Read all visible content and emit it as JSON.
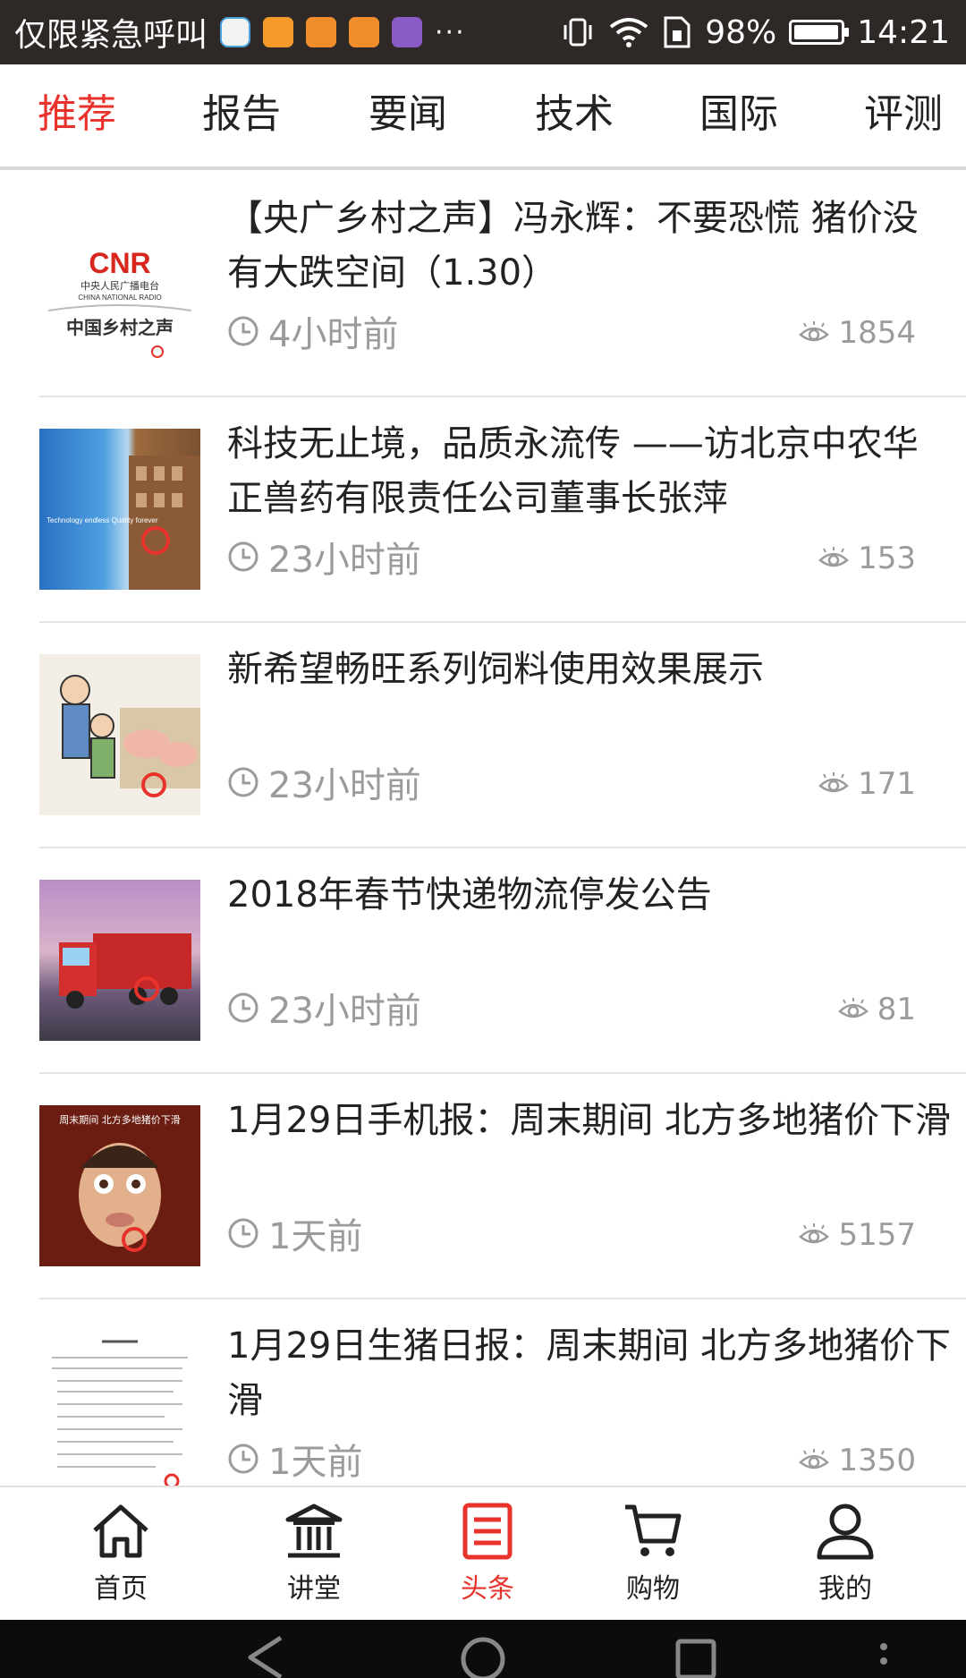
{
  "status_bar": {
    "carrier": "仅限紧急呼叫",
    "battery": "98%",
    "battery_level": 0.98,
    "time": "14:21",
    "notification_icons": [
      "browser-icon",
      "app-icon",
      "uc-icon",
      "uc-icon",
      "gallery-icon"
    ]
  },
  "tabs": [
    {
      "label": "推荐",
      "active": true
    },
    {
      "label": "报告",
      "active": false
    },
    {
      "label": "要闻",
      "active": false
    },
    {
      "label": "技术",
      "active": false
    },
    {
      "label": "国际",
      "active": false
    },
    {
      "label": "评测",
      "active": false
    }
  ],
  "articles": [
    {
      "title": "【央广乡村之声】冯永辉：不要恐慌 猪价没有大跌空间（1.30）",
      "time": "4小时前",
      "views": "1854",
      "thumb_text": "CNR",
      "thumb_sub": "中央人民广播电台",
      "thumb_sub_en": "CHINA NATIONAL RADIO",
      "thumb_caption": "中国乡村之声"
    },
    {
      "title": "科技无止境，品质永流传 ——访北京中农华正兽药有限责任公司董事长张萍",
      "time": "23小时前",
      "views": "153",
      "thumb_text": "Technology endless Quality forever"
    },
    {
      "title": "新希望畅旺系列饲料使用效果展示",
      "time": "23小时前",
      "views": "171"
    },
    {
      "title": "2018年春节快递物流停发公告",
      "time": "23小时前",
      "views": "81"
    },
    {
      "title": "1月29日手机报：周末期间 北方多地猪价下滑",
      "time": "1天前",
      "views": "5157",
      "thumb_text": "周末期间 北方多地猪价下滑"
    },
    {
      "title": "1月29日生猪日报：周末期间 北方多地猪价下滑",
      "time": "1天前",
      "views": "1350"
    }
  ],
  "bottom_nav": [
    {
      "label": "首页",
      "icon": "home-icon",
      "active": false
    },
    {
      "label": "讲堂",
      "icon": "classroom-icon",
      "active": false
    },
    {
      "label": "头条",
      "icon": "headlines-icon",
      "active": true
    },
    {
      "label": "购物",
      "icon": "cart-icon",
      "active": false
    },
    {
      "label": "我的",
      "icon": "profile-icon",
      "active": false
    }
  ],
  "colors": {
    "accent": "#e8332c",
    "status_bar_bg": "#2e2826",
    "meta_text": "#9b9b9b"
  }
}
